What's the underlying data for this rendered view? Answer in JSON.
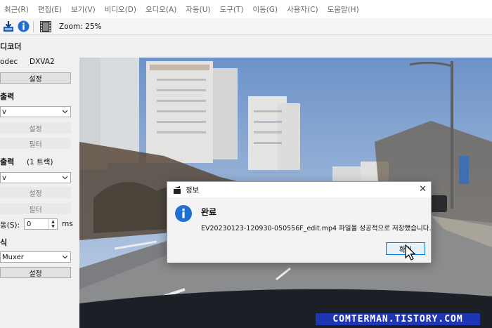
{
  "menu": [
    "최근(R)",
    "편집(E)",
    "보기(V)",
    "비디오(D)",
    "오디오(A)",
    "자동(U)",
    "도구(T)",
    "이동(G)",
    "사용자(C)",
    "도움말(H)"
  ],
  "toolbar": {
    "zoom": "Zoom: 25%"
  },
  "left_panel": {
    "decoder_title": "디코더",
    "codec_label": "odec",
    "codec_value": "DXVA2",
    "decoder_settings": "설정",
    "video_output_title": "출력",
    "video_output_combo": "v",
    "video_settings": "설정",
    "video_filter": "필터",
    "audio_output_title": "출력",
    "audio_tracks": "(1 트랙)",
    "audio_output_combo": "v",
    "audio_settings": "설정",
    "audio_filter": "필터",
    "shift_label": "동(S):",
    "shift_value": "0",
    "shift_unit": "ms",
    "format_title": "식",
    "muxer_value": "Muxer",
    "muxer_settings": "설정"
  },
  "dialog": {
    "title": "정보",
    "heading": "완료",
    "message": "EV20230123-120930-050556F_edit.mp4 파일을 성공적으로 저장했습니다.",
    "ok": "확인"
  },
  "watermark": "COMTERMAN.TISTORY.COM",
  "colors": {
    "dialog_accent": "#0078d7",
    "watermark_bg": "#1e36b4",
    "info_icon": "#1f6fd1"
  },
  "icons": [
    "save-icon",
    "info-icon",
    "filmstrip-icon",
    "dialog-app-icon",
    "close-icon",
    "info-large-icon",
    "cursor-arrow-icon"
  ]
}
